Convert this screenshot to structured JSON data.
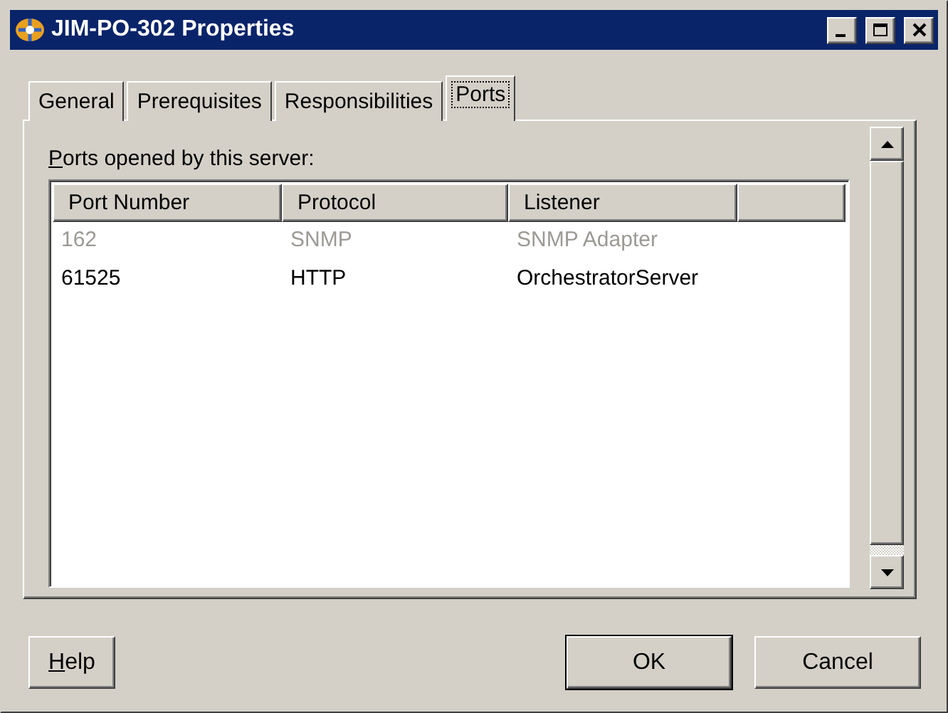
{
  "window": {
    "title": "JIM-PO-302 Properties"
  },
  "tabs": [
    {
      "label": "General",
      "selected": false
    },
    {
      "label": "Prerequisites",
      "selected": false
    },
    {
      "label": "Responsibilities",
      "selected": false
    },
    {
      "label": "Ports",
      "selected": true
    }
  ],
  "ports_label": {
    "text": "Ports opened by this server:",
    "mnemonic_first": true
  },
  "table": {
    "columns": [
      "Port Number",
      "Protocol",
      "Listener"
    ],
    "rows": [
      {
        "cells": [
          "162",
          "SNMP",
          "SNMP Adapter"
        ],
        "disabled": true
      },
      {
        "cells": [
          "61525",
          "HTTP",
          "OrchestratorServer"
        ],
        "disabled": false
      }
    ]
  },
  "buttons": [
    {
      "label": "Help",
      "mnemonic_first": true,
      "default": false
    },
    {
      "label": "OK",
      "mnemonic_first": false,
      "default": true
    },
    {
      "label": "Cancel",
      "mnemonic_first": false,
      "default": false
    }
  ]
}
